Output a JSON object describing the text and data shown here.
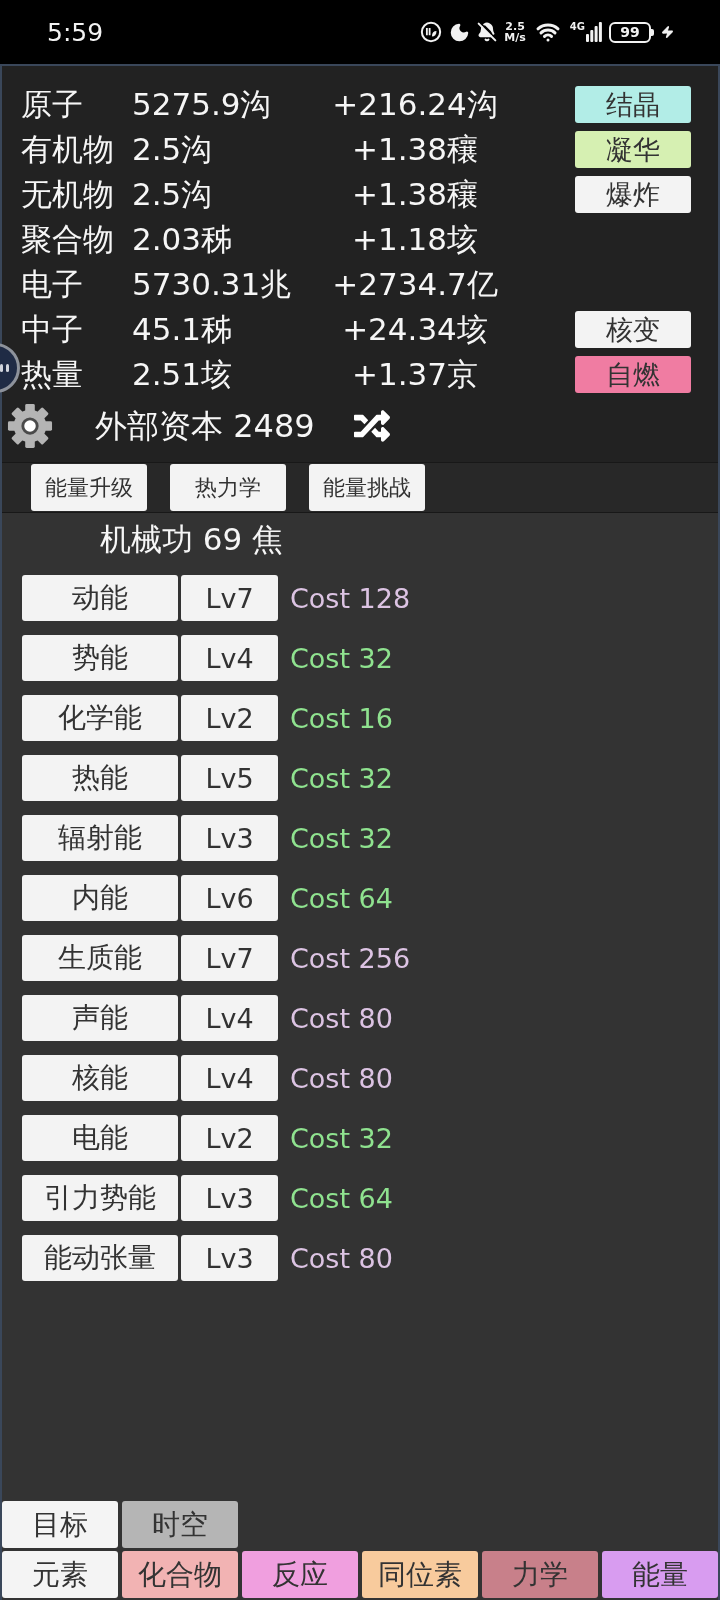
{
  "status_bar": {
    "time": "5:59",
    "speed_value": "2.5",
    "speed_unit": "M/s",
    "network": "4G",
    "battery": "99"
  },
  "resources": [
    {
      "name": "原子",
      "amount": "5275.9沟",
      "rate": "+216.24沟",
      "button": {
        "label": "结晶",
        "color": "#b2ede7"
      }
    },
    {
      "name": "有机物",
      "amount": "2.5沟",
      "rate": "+1.38穰",
      "button": {
        "label": "凝华",
        "color": "#d6f0b2"
      }
    },
    {
      "name": "无机物",
      "amount": "2.5沟",
      "rate": "+1.38穰",
      "button": {
        "label": "爆炸",
        "color": "#f3f3f3"
      }
    },
    {
      "name": "聚合物",
      "amount": "2.03秭",
      "rate": "+1.18垓"
    },
    {
      "name": "电子",
      "amount": "5730.31兆",
      "rate": "+2734.7亿"
    },
    {
      "name": "中子",
      "amount": "45.1秭",
      "rate": "+24.34垓",
      "button": {
        "label": "核变",
        "color": "#f3f3f3"
      }
    },
    {
      "name": "热量",
      "amount": "2.51垓",
      "rate": "+1.37京",
      "button": {
        "label": "自燃",
        "color": "#f07ca2"
      }
    }
  ],
  "external_capital": "外部资本 2489",
  "sub_tabs": [
    "能量升级",
    "热力学",
    "能量挑战"
  ],
  "mechanical_work": "机械功 69 焦",
  "upgrades": [
    {
      "name": "动能",
      "level": "Lv7",
      "cost": "Cost 128",
      "affordable": false
    },
    {
      "name": "势能",
      "level": "Lv4",
      "cost": "Cost 32",
      "affordable": true
    },
    {
      "name": "化学能",
      "level": "Lv2",
      "cost": "Cost 16",
      "affordable": true
    },
    {
      "name": "热能",
      "level": "Lv5",
      "cost": "Cost 32",
      "affordable": true
    },
    {
      "name": "辐射能",
      "level": "Lv3",
      "cost": "Cost 32",
      "affordable": true
    },
    {
      "name": "内能",
      "level": "Lv6",
      "cost": "Cost 64",
      "affordable": true
    },
    {
      "name": "生质能",
      "level": "Lv7",
      "cost": "Cost 256",
      "affordable": false
    },
    {
      "name": "声能",
      "level": "Lv4",
      "cost": "Cost 80",
      "affordable": false
    },
    {
      "name": "核能",
      "level": "Lv4",
      "cost": "Cost 80",
      "affordable": false
    },
    {
      "name": "电能",
      "level": "Lv2",
      "cost": "Cost 32",
      "affordable": true
    },
    {
      "name": "引力势能",
      "level": "Lv3",
      "cost": "Cost 64",
      "affordable": true
    },
    {
      "name": "能动张量",
      "level": "Lv3",
      "cost": "Cost 80",
      "affordable": false
    }
  ],
  "nav_rows": [
    [
      {
        "label": "目标",
        "color": "#f4f4f4"
      },
      {
        "label": "时空",
        "color": "#b5b5b5"
      }
    ],
    [
      {
        "label": "元素",
        "color": "#f4f4f4"
      },
      {
        "label": "化合物",
        "color": "#f2b3b3"
      },
      {
        "label": "反应",
        "color": "#f09fdf"
      },
      {
        "label": "同位素",
        "color": "#f8cb9d"
      },
      {
        "label": "力学",
        "color": "#c8808a"
      },
      {
        "label": "能量",
        "color": "#d89cf0"
      }
    ]
  ]
}
